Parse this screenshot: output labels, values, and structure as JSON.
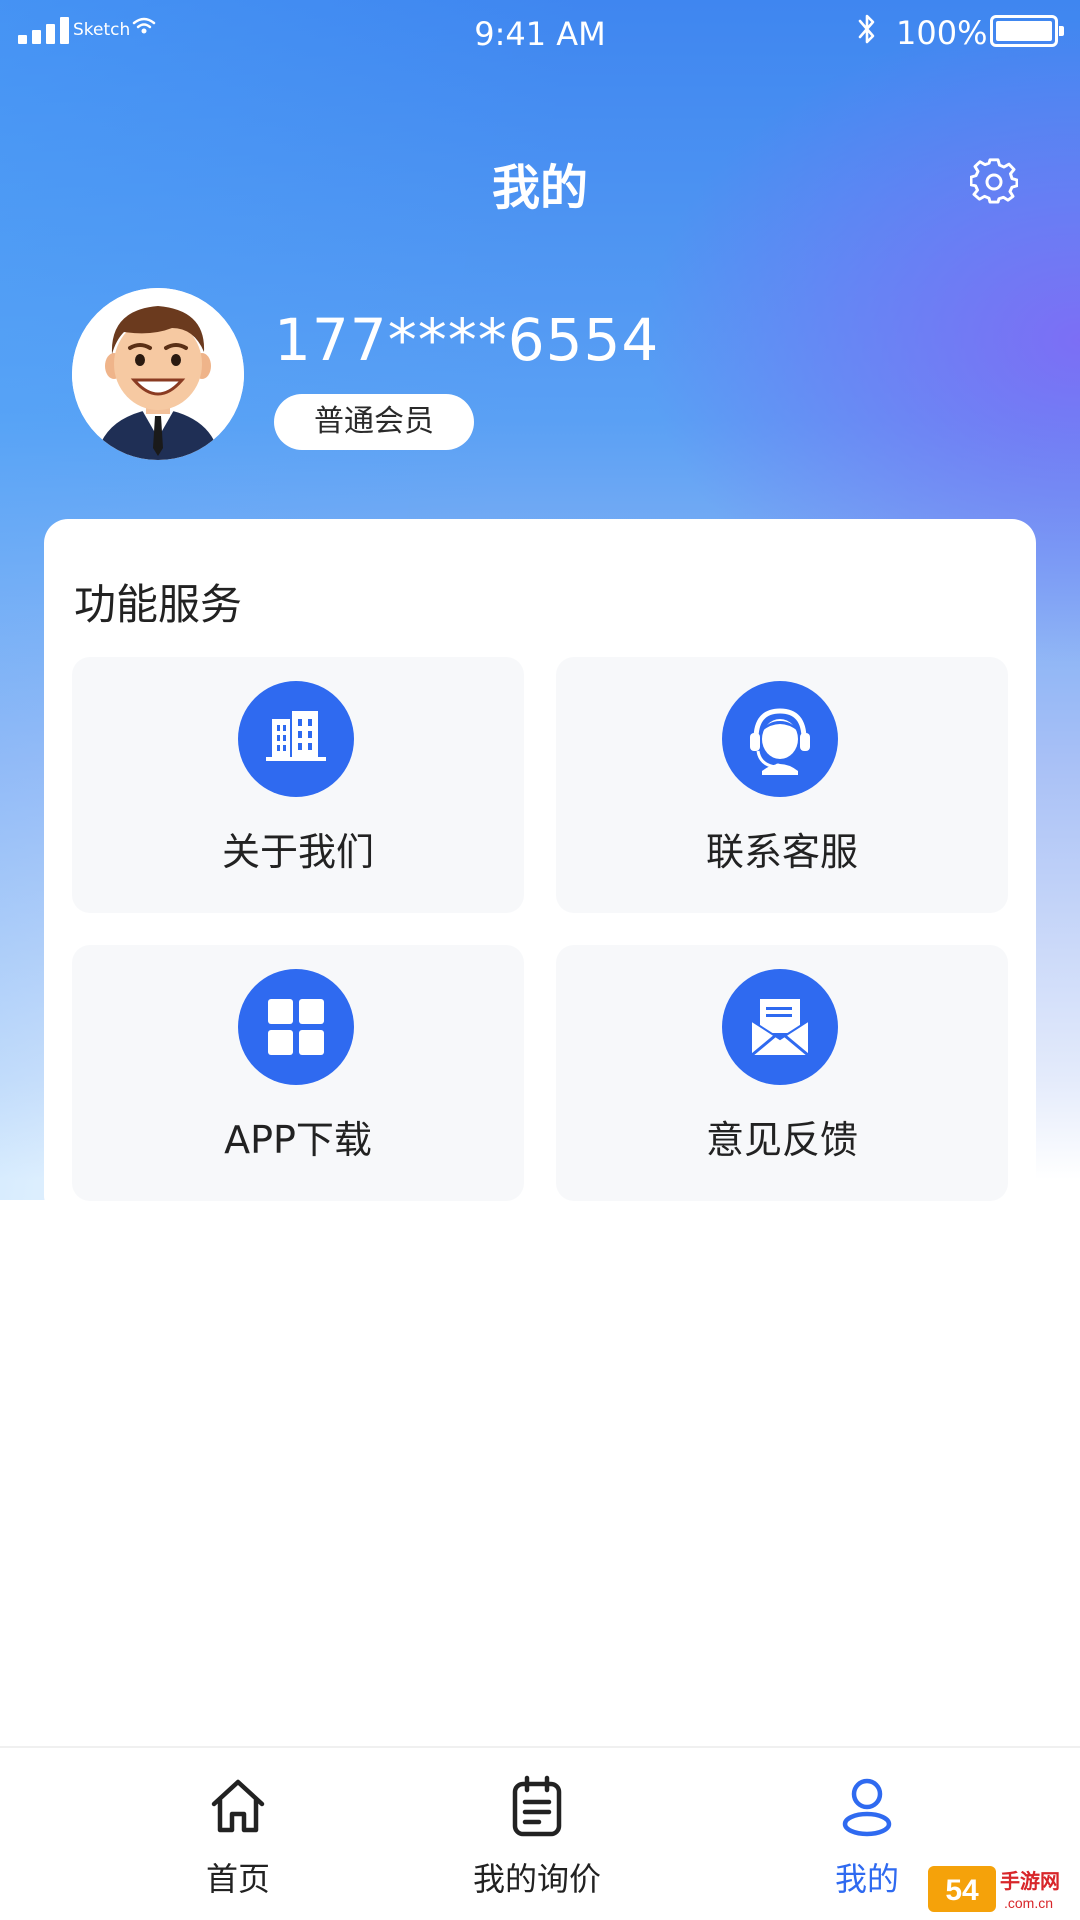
{
  "status_bar": {
    "carrier": "Sketch",
    "time": "9:41 AM",
    "battery": "100%"
  },
  "header": {
    "title": "我的",
    "settings_icon": "gear-icon"
  },
  "profile": {
    "phone": "177****6554",
    "member_level": "普通会员",
    "avatar_icon": "user-avatar-cartoon"
  },
  "services": {
    "title": "功能服务",
    "accent": "#2f6af0",
    "items": [
      {
        "label": "关于我们",
        "icon": "building-icon"
      },
      {
        "label": "联系客服",
        "icon": "headset-icon"
      },
      {
        "label": "APP下载",
        "icon": "grid-icon"
      },
      {
        "label": "意见反馈",
        "icon": "mail-icon"
      }
    ]
  },
  "tab_bar": {
    "items": [
      {
        "label": "首页",
        "icon": "home-icon",
        "active": false
      },
      {
        "label": "我的询价",
        "icon": "clipboard-icon",
        "active": false
      },
      {
        "label": "我的",
        "icon": "user-icon",
        "active": true
      }
    ],
    "active_color": "#2f6af0"
  },
  "watermark": {
    "text": "54手游网",
    "sub": ".com.cn"
  }
}
